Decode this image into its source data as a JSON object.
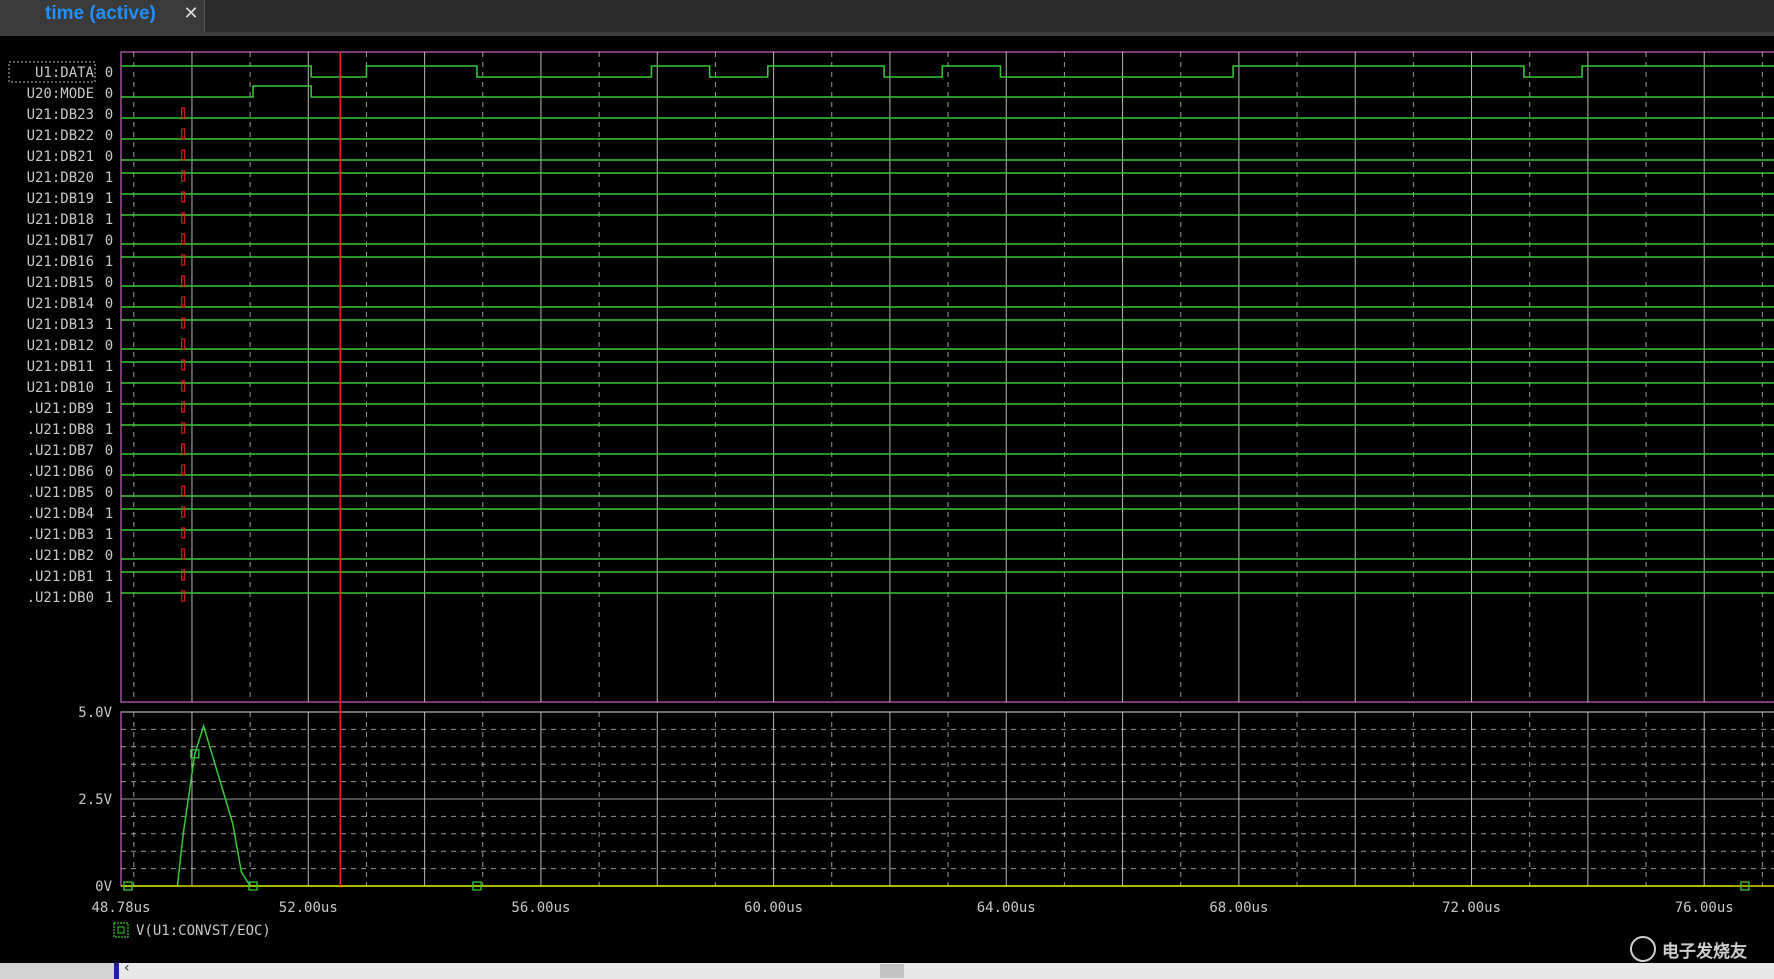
{
  "tab": {
    "title": "time (active)",
    "close_icon": "close-icon"
  },
  "digital": {
    "signals": [
      {
        "name": "U1:DATA",
        "value": "0"
      },
      {
        "name": "U20:MODE",
        "value": "0"
      },
      {
        "name": "U21:DB23",
        "value": "0"
      },
      {
        "name": "U21:DB22",
        "value": "0"
      },
      {
        "name": "U21:DB21",
        "value": "0"
      },
      {
        "name": "U21:DB20",
        "value": "1"
      },
      {
        "name": "U21:DB19",
        "value": "1"
      },
      {
        "name": "U21:DB18",
        "value": "1"
      },
      {
        "name": "U21:DB17",
        "value": "0"
      },
      {
        "name": "U21:DB16",
        "value": "1"
      },
      {
        "name": "U21:DB15",
        "value": "0"
      },
      {
        "name": "U21:DB14",
        "value": "0"
      },
      {
        "name": "U21:DB13",
        "value": "1"
      },
      {
        "name": "U21:DB12",
        "value": "0"
      },
      {
        "name": "U21:DB11",
        "value": "1"
      },
      {
        "name": "U21:DB10",
        "value": "1"
      },
      {
        "name": ".U21:DB9",
        "value": "1"
      },
      {
        "name": ".U21:DB8",
        "value": "1"
      },
      {
        "name": ".U21:DB7",
        "value": "0"
      },
      {
        "name": ".U21:DB6",
        "value": "0"
      },
      {
        "name": ".U21:DB5",
        "value": "0"
      },
      {
        "name": ".U21:DB4",
        "value": "1"
      },
      {
        "name": ".U21:DB3",
        "value": "1"
      },
      {
        "name": ".U21:DB2",
        "value": "0"
      },
      {
        "name": ".U21:DB1",
        "value": "1"
      },
      {
        "name": ".U21:DB0",
        "value": "1"
      }
    ],
    "data_transitions_us": [
      52.05,
      53.0,
      54.9,
      57.9,
      58.9,
      59.9,
      61.9,
      62.9,
      63.9,
      67.9,
      72.9,
      73.9
    ]
  },
  "analog": {
    "y_tick_labels": [
      "5.0V",
      "2.5V",
      "0V"
    ],
    "ylim": [
      0,
      5
    ],
    "trace_label": "V(U1:CONVST/EOC)",
    "pulse": [
      [
        48.8,
        0
      ],
      [
        49.75,
        0
      ],
      [
        49.85,
        1.5
      ],
      [
        50.05,
        3.8
      ],
      [
        50.2,
        4.6
      ],
      [
        50.45,
        3.2
      ],
      [
        50.7,
        1.8
      ],
      [
        50.85,
        0.4
      ],
      [
        51.0,
        0
      ],
      [
        76.5,
        0
      ]
    ]
  },
  "time_axis": {
    "tick_labels": [
      "48.78us",
      "52.00us",
      "56.00us",
      "60.00us",
      "64.00us",
      "68.00us",
      "72.00us",
      "76.00us"
    ],
    "range_us": [
      48.78,
      77.2
    ]
  },
  "cursor": {
    "time_us": 52.55
  },
  "colors": {
    "digital_trace": "#37c837",
    "analog_trace": "#37c837",
    "zero_trace": "#d8d800",
    "cursor": "#ff1e1e",
    "grid": "#d8d8d8",
    "label_text": "#c8c8c8",
    "frame": "#a050a0",
    "tab_text": "#1e90ff"
  },
  "watermark": {
    "text": "电子发烧友"
  }
}
